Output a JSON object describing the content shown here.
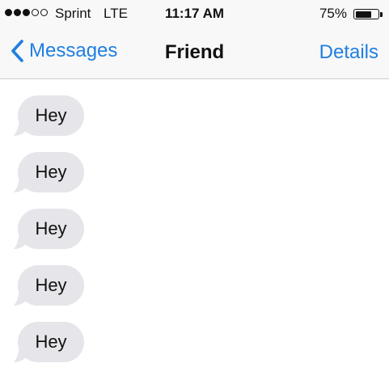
{
  "status_bar": {
    "signal_bars_filled": 3,
    "signal_bars_total": 5,
    "carrier": "Sprint",
    "network": "LTE",
    "time": "11:17 AM",
    "battery_percent_label": "75%",
    "battery_level": 0.75
  },
  "nav": {
    "back_label": "Messages",
    "title": "Friend",
    "details_label": "Details",
    "accent_color": "#1f7fe0"
  },
  "conversation": {
    "bubble_color": "#e5e5ea",
    "messages": [
      {
        "text": "Hey",
        "direction": "incoming"
      },
      {
        "text": "Hey",
        "direction": "incoming"
      },
      {
        "text": "Hey",
        "direction": "incoming"
      },
      {
        "text": "Hey",
        "direction": "incoming"
      },
      {
        "text": "Hey",
        "direction": "incoming"
      }
    ]
  }
}
